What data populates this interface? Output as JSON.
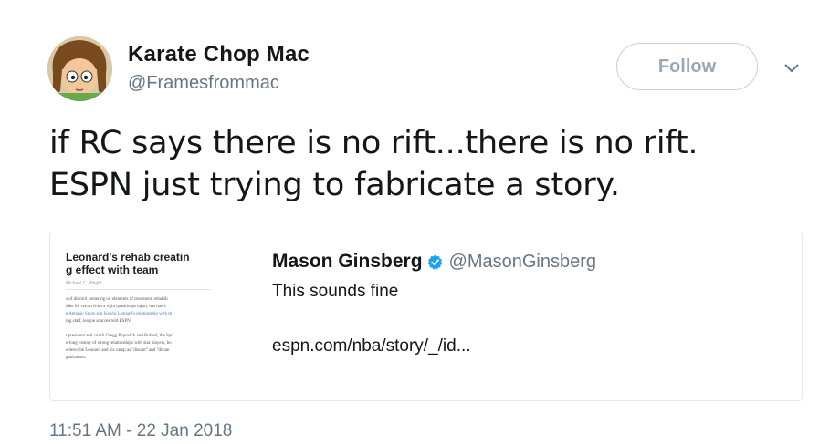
{
  "author": {
    "name": "Karate Chop Mac",
    "handle": "@Framesfrommac"
  },
  "follow_label": "Follow",
  "tweet_text": [
    "if RC says there is no rift...there is no rift.",
    "ESPN just trying to fabricate a story."
  ],
  "quote": {
    "name": "Mason Ginsberg",
    "handle": "@MasonGinsberg",
    "text": "This sounds fine",
    "link": "espn.com/nba/story/_/id...",
    "thumbnail": {
      "headline_1": "Leonard's rehab creatin",
      "headline_2": "g effect with team",
      "byline": "Michael C. Wright",
      "body": [
        "s of discord centering on elements of treatment, rehabili",
        "dike for return from a right quadriceps injury has had s",
        "e Antonio Spurs star Kawhi Leonard's relationship with th",
        "ing staff, league sources told ESPN.",
        "",
        "t president and coach Gregg Popovich and Buford, the Spu",
        "e-long history of strong relationships with star players, bu",
        "e describe Leonard and his camp as \"distant\" and \"distan",
        "ganization."
      ]
    }
  },
  "timestamp": "11:51 AM - 22 Jan 2018",
  "colors": {
    "text": "#14171a",
    "secondary": "#657786",
    "border": "#e1e8ed",
    "verified": "#1da1f2"
  }
}
